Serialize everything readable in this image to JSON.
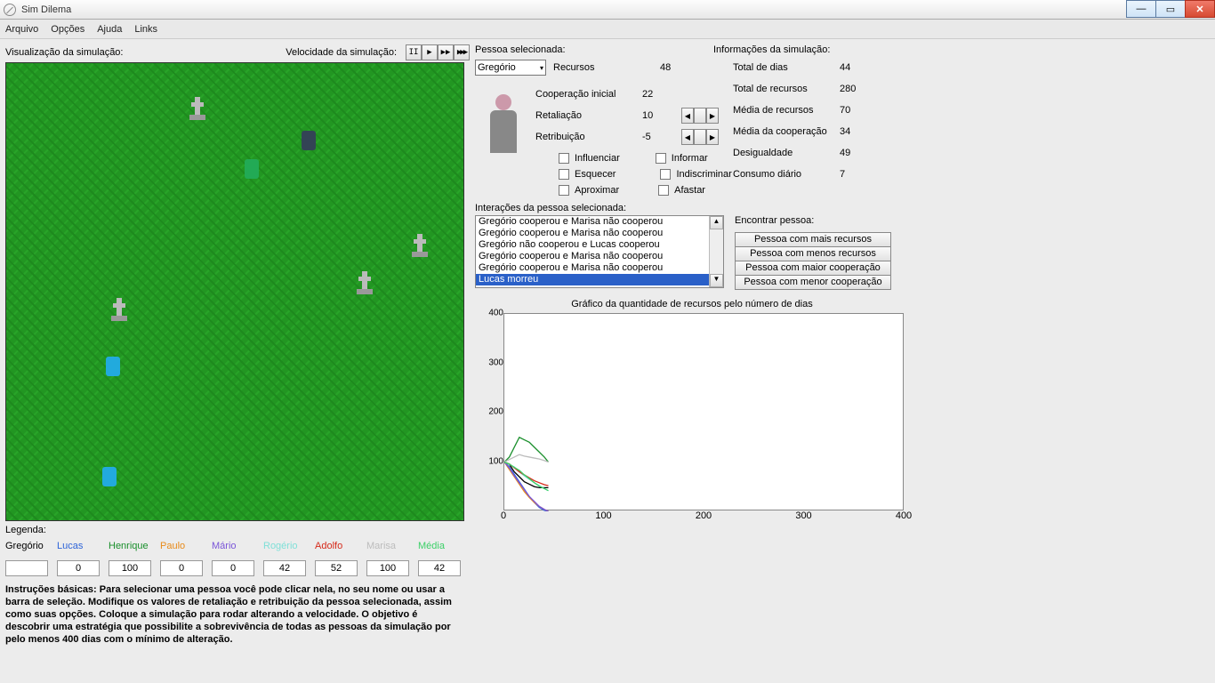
{
  "window": {
    "title": "Sim Dilema"
  },
  "menu": {
    "arquivo": "Arquivo",
    "opcoes": "Opções",
    "ajuda": "Ajuda",
    "links": "Links"
  },
  "labels": {
    "viz": "Visualização da simulação:",
    "speed": "Velocidade da simulação:",
    "selperson": "Pessoa selecionada:",
    "siminfo": "Informações da simulação:",
    "interactions": "Interações da pessoa selecionada:",
    "find": "Encontrar pessoa:",
    "charttitle": "Gráfico da quantidade de recursos pelo número de dias",
    "legend": "Legenda:"
  },
  "selected": {
    "name": "Gregório",
    "f": {
      "recursos_l": "Recursos",
      "recursos_v": "48",
      "coop_l": "Cooperação inicial",
      "coop_v": "22",
      "ret_l": "Retaliação",
      "ret_v": "10",
      "retr_l": "Retribuição",
      "retr_v": "-5"
    },
    "chk": {
      "influenciar": "Influenciar",
      "informar": "Informar",
      "esquecer": "Esquecer",
      "indiscriminar": "Indiscriminar",
      "aproximar": "Aproximar",
      "afastar": "Afastar"
    }
  },
  "sim": {
    "dias_l": "Total de dias",
    "dias_v": "44",
    "rec_l": "Total de recursos",
    "rec_v": "280",
    "mrec_l": "Média de recursos",
    "mrec_v": "70",
    "mcoop_l": "Média da cooperação",
    "mcoop_v": "34",
    "desig_l": "Desigualdade",
    "desig_v": "49",
    "cons_l": "Consumo diário",
    "cons_v": "7"
  },
  "interactions": [
    "Gregório cooperou e Marisa não cooperou",
    "Gregório cooperou e Marisa não cooperou",
    "Gregório não cooperou e Lucas cooperou",
    "Gregório cooperou e Marisa não cooperou",
    "Gregório cooperou e Marisa não cooperou",
    "Lucas morreu"
  ],
  "findbtns": {
    "a": "Pessoa com mais recursos",
    "b": "Pessoa com menos recursos",
    "c": "Pessoa com maior cooperação",
    "d": "Pessoa com menor cooperação"
  },
  "legend": [
    {
      "name": "Gregório",
      "color": "#000",
      "val": ""
    },
    {
      "name": "Lucas",
      "color": "#2e64d8",
      "val": "0"
    },
    {
      "name": "Henrique",
      "color": "#1a8f2c",
      "val": "100"
    },
    {
      "name": "Paulo",
      "color": "#e88b1a",
      "val": "0"
    },
    {
      "name": "Mário",
      "color": "#7a55d8",
      "val": "0"
    },
    {
      "name": "Rogério",
      "color": "#7fe0d8",
      "val": "42"
    },
    {
      "name": "Adolfo",
      "color": "#d62a1a",
      "val": "52"
    },
    {
      "name": "Marisa",
      "color": "#bcbcbc",
      "val": "100"
    },
    {
      "name": "Média",
      "color": "#3cd068",
      "val": "42"
    }
  ],
  "instructions": "Instruções básicas: Para selecionar uma pessoa você pode clicar nela, no seu nome ou usar a barra de seleção. Modifique os valores de retaliação e retribuição da pessoa selecionada, assim como suas opções. Coloque a simulação para rodar alterando a velocidade. O objetivo é descobrir uma estratégia que possibilite a sobrevivência de todas as pessoas da simulação por pelo menos 400 dias com o mínimo de alteração.",
  "chart_data": {
    "type": "line",
    "title": "Gráfico da quantidade de recursos pelo número de dias",
    "xlabel": "",
    "ylabel": "",
    "xlim": [
      0,
      400
    ],
    "ylim": [
      0,
      400
    ],
    "xticks": [
      0,
      100,
      200,
      300,
      400
    ],
    "yticks": [
      100,
      200,
      300,
      400
    ],
    "series": [
      {
        "name": "Gregório",
        "color": "#000",
        "x": [
          0,
          5,
          10,
          15,
          20,
          25,
          30,
          35,
          40,
          44
        ],
        "y": [
          100,
          95,
          80,
          70,
          60,
          55,
          50,
          48,
          48,
          48
        ]
      },
      {
        "name": "Lucas",
        "color": "#2e64d8",
        "x": [
          0,
          5,
          10,
          15,
          20,
          25,
          30,
          35,
          40,
          44
        ],
        "y": [
          100,
          90,
          75,
          60,
          45,
          30,
          18,
          8,
          2,
          0
        ]
      },
      {
        "name": "Henrique",
        "color": "#1a8f2c",
        "x": [
          0,
          5,
          10,
          15,
          20,
          25,
          30,
          35,
          40,
          44
        ],
        "y": [
          100,
          110,
          130,
          150,
          145,
          140,
          130,
          120,
          110,
          100
        ]
      },
      {
        "name": "Paulo",
        "color": "#e88b1a",
        "x": [
          0,
          5,
          10,
          15,
          20,
          25,
          30,
          35,
          40,
          44
        ],
        "y": [
          100,
          85,
          70,
          55,
          40,
          28,
          18,
          10,
          4,
          0
        ]
      },
      {
        "name": "Mário",
        "color": "#7a55d8",
        "x": [
          0,
          5,
          10,
          15,
          20,
          25,
          30,
          35,
          40,
          44
        ],
        "y": [
          100,
          88,
          72,
          58,
          44,
          30,
          20,
          10,
          4,
          0
        ]
      },
      {
        "name": "Rogério",
        "color": "#7fe0d8",
        "x": [
          0,
          5,
          10,
          15,
          20,
          25,
          30,
          35,
          40,
          44
        ],
        "y": [
          100,
          95,
          90,
          80,
          72,
          65,
          58,
          52,
          46,
          42
        ]
      },
      {
        "name": "Adolfo",
        "color": "#d62a1a",
        "x": [
          0,
          5,
          10,
          15,
          20,
          25,
          30,
          35,
          40,
          44
        ],
        "y": [
          100,
          96,
          88,
          80,
          74,
          68,
          62,
          58,
          54,
          52
        ]
      },
      {
        "name": "Marisa",
        "color": "#bcbcbc",
        "x": [
          0,
          5,
          10,
          15,
          20,
          25,
          30,
          35,
          40,
          44
        ],
        "y": [
          100,
          105,
          110,
          115,
          112,
          110,
          108,
          106,
          103,
          100
        ]
      },
      {
        "name": "Média",
        "color": "#3cd068",
        "x": [
          0,
          5,
          10,
          15,
          20,
          25,
          30,
          35,
          40,
          44
        ],
        "y": [
          100,
          96,
          89,
          83,
          74,
          66,
          58,
          51,
          46,
          42
        ]
      }
    ]
  }
}
